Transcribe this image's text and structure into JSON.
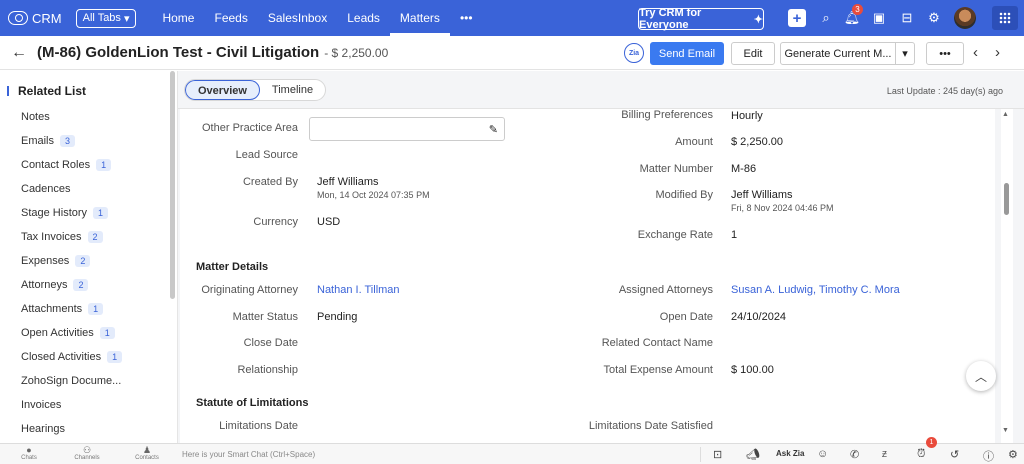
{
  "topbar": {
    "brand": "CRM",
    "all_tabs": "All Tabs",
    "nav": [
      "Home",
      "Feeds",
      "SalesInbox",
      "Leads",
      "Matters",
      "•••"
    ],
    "active_nav": "Matters",
    "try_crm": "Try CRM for Everyone",
    "notification_count": "3"
  },
  "record": {
    "title": "(M-86) GoldenLion Test - Civil Litigation",
    "amount": "- $ 2,250.00",
    "zia": "Zia",
    "send_email": "Send Email",
    "edit": "Edit",
    "generate": "Generate Current M...",
    "more": "•••"
  },
  "sidebar": {
    "header": "Related List",
    "items": [
      {
        "label": "Notes",
        "count": ""
      },
      {
        "label": "Emails",
        "count": "3"
      },
      {
        "label": "Contact Roles",
        "count": "1"
      },
      {
        "label": "Cadences",
        "count": ""
      },
      {
        "label": "Stage History",
        "count": "1"
      },
      {
        "label": "Tax Invoices",
        "count": "2"
      },
      {
        "label": "Expenses",
        "count": "2"
      },
      {
        "label": "Attorneys",
        "count": "2"
      },
      {
        "label": "Attachments",
        "count": "1"
      },
      {
        "label": "Open Activities",
        "count": "1"
      },
      {
        "label": "Closed Activities",
        "count": "1"
      },
      {
        "label": "ZohoSign Docume...",
        "count": ""
      },
      {
        "label": "Invoices",
        "count": ""
      },
      {
        "label": "Hearings",
        "count": ""
      }
    ]
  },
  "tabs": {
    "overview": "Overview",
    "timeline": "Timeline",
    "last_update": "Last Update : 245 day(s) ago"
  },
  "fields": {
    "other_practice_area": {
      "label": "Other Practice Area",
      "value": ""
    },
    "lead_source": {
      "label": "Lead Source",
      "value": ""
    },
    "created_by": {
      "label": "Created By",
      "value": "Jeff Williams",
      "sub": "Mon, 14 Oct 2024 07:35 PM"
    },
    "currency": {
      "label": "Currency",
      "value": "USD"
    },
    "billing_preferences": {
      "label": "Billing Preferences",
      "value": "Hourly"
    },
    "amount": {
      "label": "Amount",
      "value": "$ 2,250.00"
    },
    "matter_number": {
      "label": "Matter Number",
      "value": "M-86"
    },
    "modified_by": {
      "label": "Modified By",
      "value": "Jeff Williams",
      "sub": "Fri, 8 Nov 2024 04:46 PM"
    },
    "exchange_rate": {
      "label": "Exchange Rate",
      "value": "1"
    }
  },
  "matter_details": {
    "heading": "Matter Details",
    "originating_attorney": {
      "label": "Originating Attorney",
      "value": "Nathan I. Tillman"
    },
    "matter_status": {
      "label": "Matter Status",
      "value": "Pending"
    },
    "close_date": {
      "label": "Close Date",
      "value": ""
    },
    "relationship": {
      "label": "Relationship",
      "value": ""
    },
    "assigned_attorneys": {
      "label": "Assigned Attorneys",
      "value": "Susan A. Ludwig, Timothy C. Mora"
    },
    "open_date": {
      "label": "Open Date",
      "value": "24/10/2024"
    },
    "related_contact_name": {
      "label": "Related Contact Name",
      "value": ""
    },
    "total_expense_amount": {
      "label": "Total Expense Amount",
      "value": "$ 100.00"
    }
  },
  "statute": {
    "heading": "Statute of Limitations",
    "limitations_date": {
      "label": "Limitations Date",
      "value": ""
    },
    "limitations_date_satisfied": {
      "label": "Limitations Date Satisfied",
      "value": ""
    }
  },
  "bottombar": {
    "chats": "Chats",
    "channels": "Channels",
    "contacts": "Contacts",
    "smart_chat_placeholder": "Here is your Smart Chat (Ctrl+Space)",
    "ask_zia": "Ask Zia",
    "alarm_count": "1"
  }
}
